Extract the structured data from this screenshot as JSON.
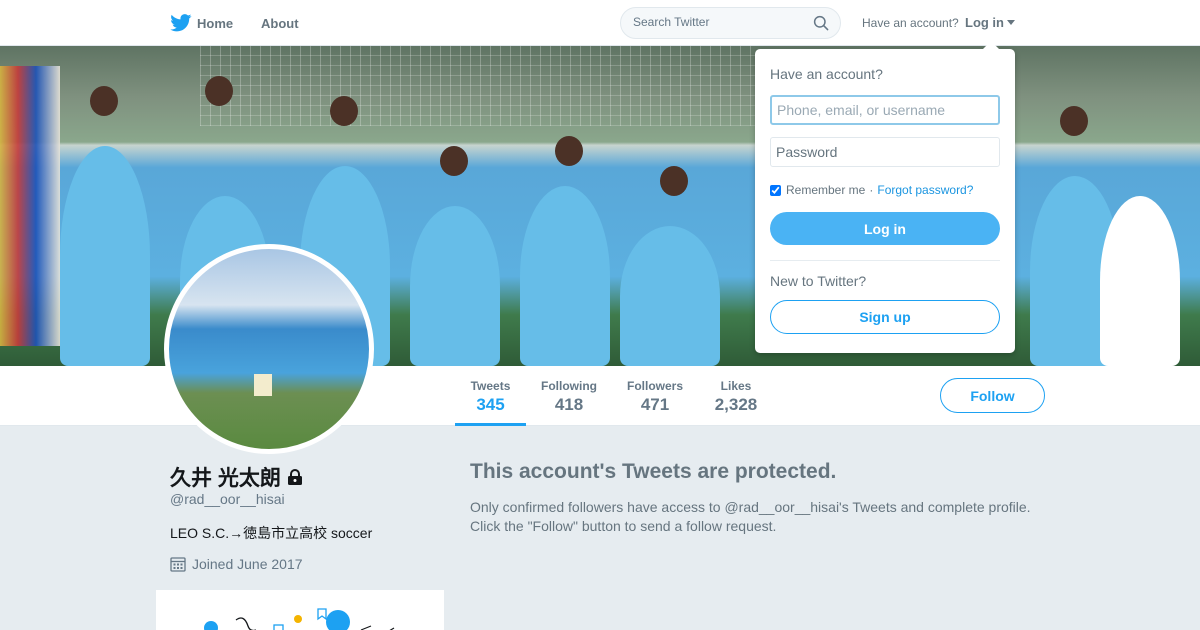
{
  "nav": {
    "home_label": "Home",
    "about_label": "About",
    "search_placeholder": "Search Twitter",
    "have_account": "Have an account?",
    "login_label": "Log in"
  },
  "profile": {
    "name": "久井 光太朗",
    "handle": "@rad__oor__hisai",
    "bio": "LEO S.C.→徳島市立高校 soccer",
    "joined": "Joined June 2017",
    "protected": true
  },
  "stats": [
    {
      "label": "Tweets",
      "value": "345",
      "active": true
    },
    {
      "label": "Following",
      "value": "418",
      "active": false
    },
    {
      "label": "Followers",
      "value": "471",
      "active": false
    },
    {
      "label": "Likes",
      "value": "2,328",
      "active": false
    }
  ],
  "follow_label": "Follow",
  "protected_message": {
    "title": "This account's Tweets are protected.",
    "line1": "Only confirmed followers have access to @rad__oor__hisai's Tweets and complete profile.",
    "line2": "Click the \"Follow\" button to send a follow request."
  },
  "login_dropdown": {
    "heading": "Have an account?",
    "username_placeholder": "Phone, email, or username",
    "password_placeholder": "Password",
    "remember_label": "Remember me",
    "remember_checked": true,
    "separator": "·",
    "forgot_label": "Forgot password?",
    "login_button": "Log in",
    "new_heading": "New to Twitter?",
    "signup_button": "Sign up"
  },
  "colors": {
    "accent": "#1da1f2",
    "background": "#e6ecf0",
    "muted": "#657786"
  }
}
